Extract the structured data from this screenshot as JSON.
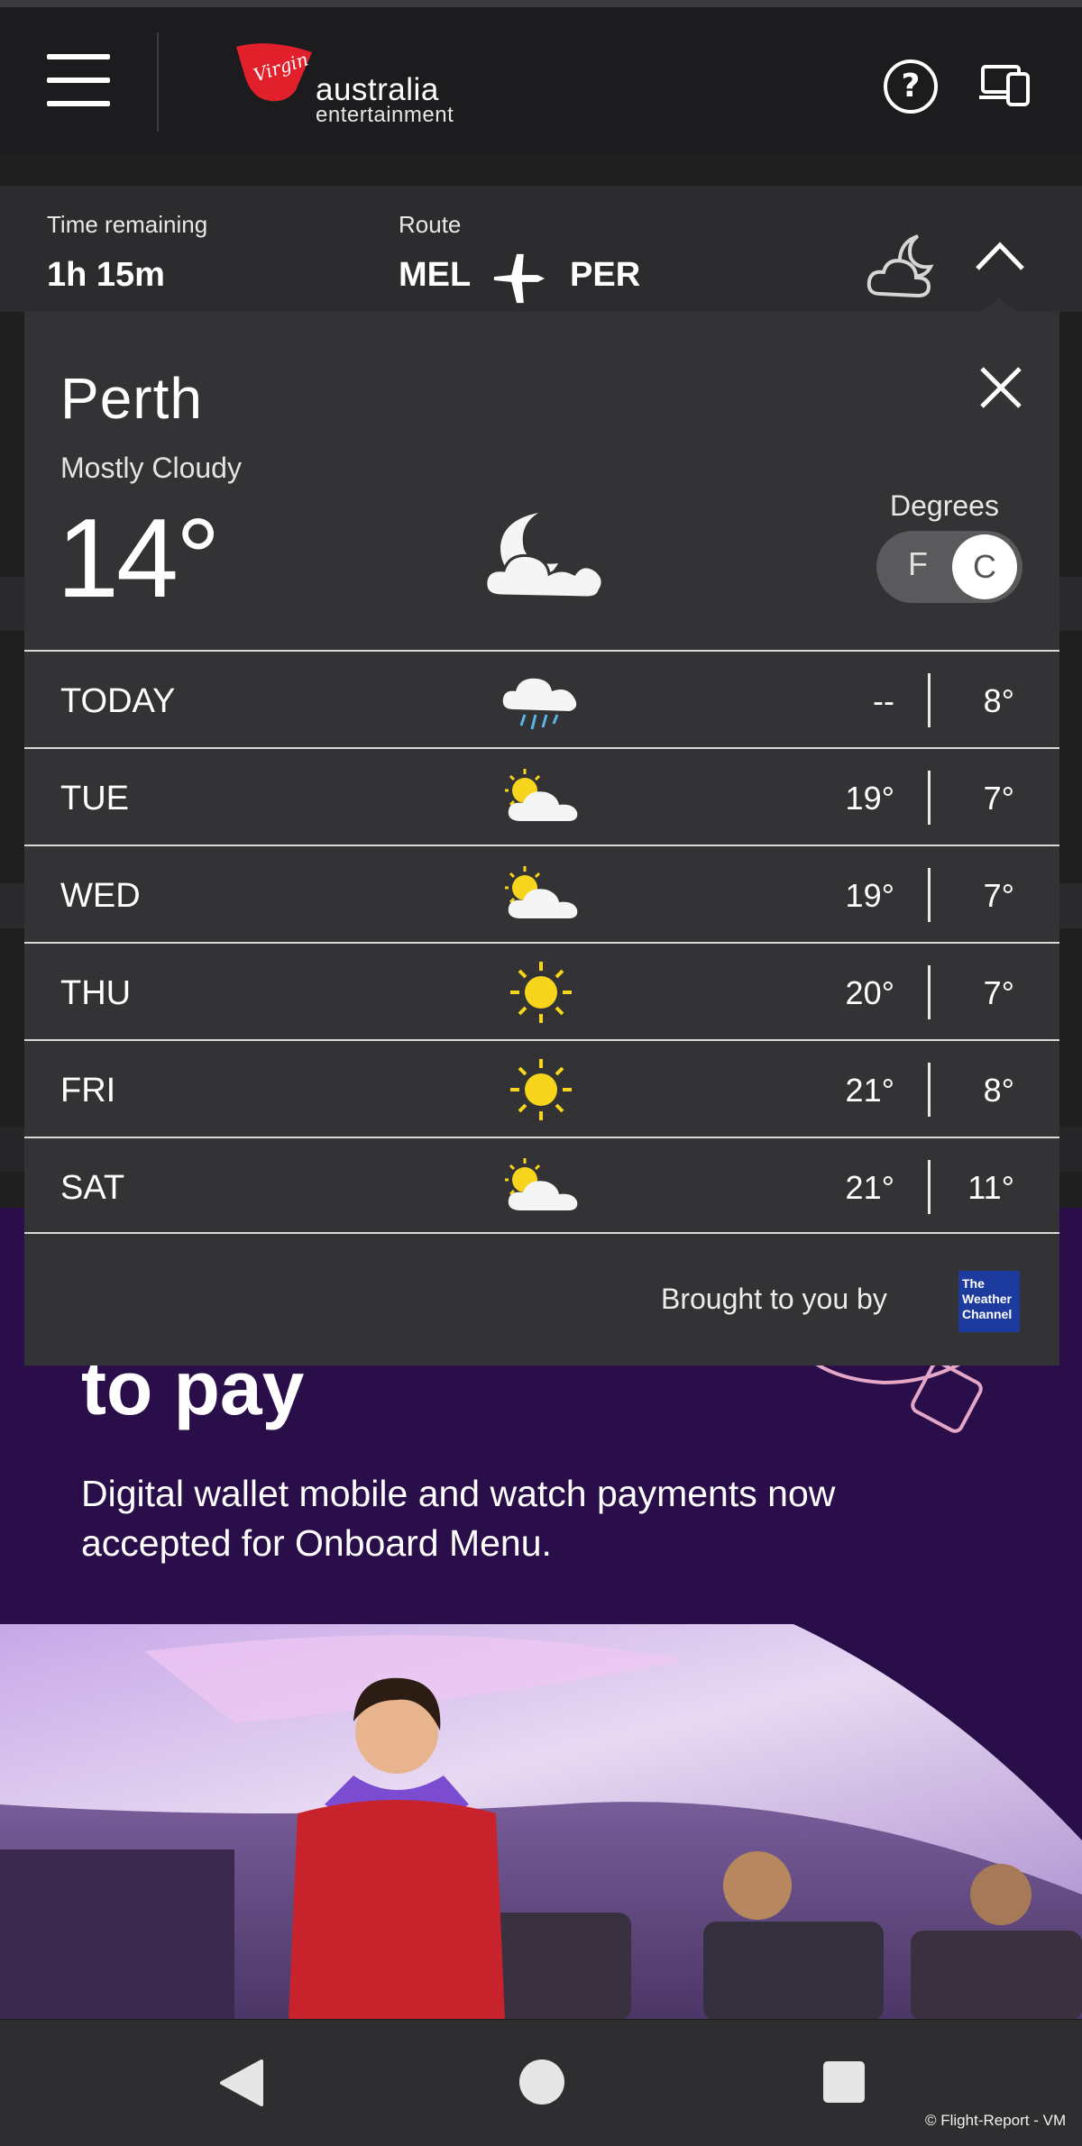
{
  "app": {
    "brand_name": "australia",
    "brand_sub": "entertainment",
    "logo_script": "Virgin"
  },
  "flight": {
    "time_remaining_label": "Time remaining",
    "time_remaining_value": "1h 15m",
    "route_label": "Route",
    "origin": "MEL",
    "destination": "PER"
  },
  "weather": {
    "city": "Perth",
    "condition": "Mostly Cloudy",
    "current_temp": "14°",
    "current_icon": "moon-cloud-icon",
    "degrees_label": "Degrees",
    "unit_f": "F",
    "unit_c": "C",
    "selected_unit": "C",
    "forecast": [
      {
        "day": "TODAY",
        "icon": "rain-cloud-icon",
        "high": "--",
        "low": "8°"
      },
      {
        "day": "TUE",
        "icon": "sun-cloud-icon",
        "high": "19°",
        "low": "7°"
      },
      {
        "day": "WED",
        "icon": "sun-cloud-icon",
        "high": "19°",
        "low": "7°"
      },
      {
        "day": "THU",
        "icon": "sun-icon",
        "high": "20°",
        "low": "7°"
      },
      {
        "day": "FRI",
        "icon": "sun-icon",
        "high": "21°",
        "low": "8°"
      },
      {
        "day": "SAT",
        "icon": "sun-cloud-icon",
        "high": "21°",
        "low": "11°"
      }
    ],
    "sponsor_text": "Brought to you by",
    "sponsor_logo_lines": [
      "The",
      "Weather",
      "Channel"
    ]
  },
  "promo": {
    "title": "to pay",
    "body": "Digital wallet mobile and watch payments now accepted for Onboard Menu."
  },
  "footer": {
    "watermark": "© Flight-Report - VM"
  },
  "colors": {
    "background": "#1f1f20",
    "card": "#333335",
    "promo_purple": "#2a0e4a",
    "brand_red": "#e2202c",
    "sun_yellow": "#f7d51d",
    "rain_blue": "#5ab4e6"
  }
}
